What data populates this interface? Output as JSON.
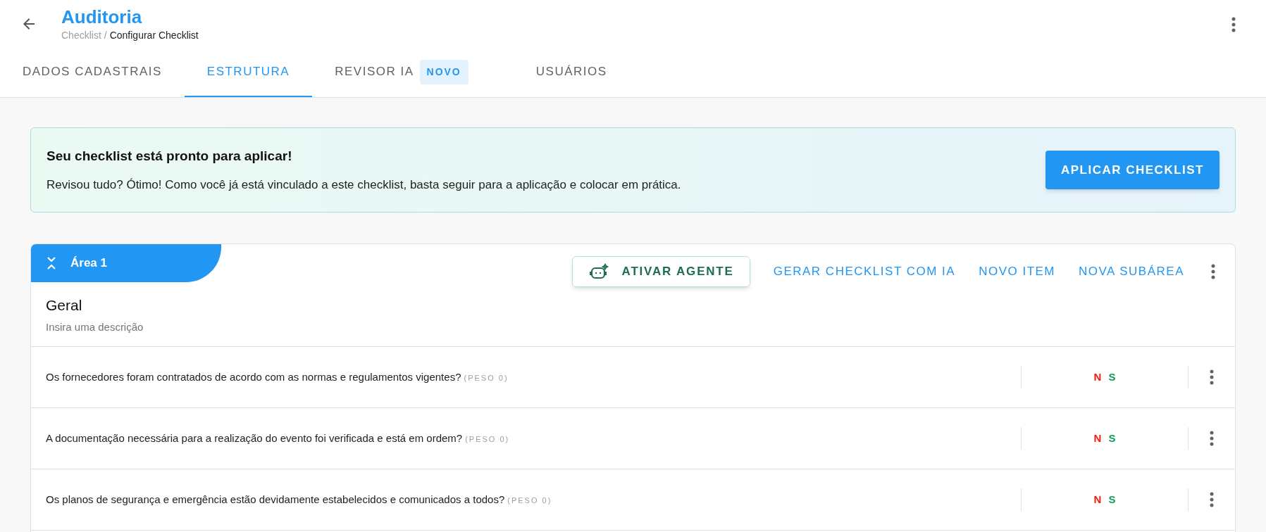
{
  "header": {
    "title": "Auditoria",
    "breadcrumb": [
      "Checklist",
      "Configurar Checklist"
    ],
    "breadcrumb_separator": "/"
  },
  "tabs": [
    {
      "label": "DADOS CADASTRAIS",
      "selected": false
    },
    {
      "label": "ESTRUTURA",
      "selected": true
    },
    {
      "label": "REVISOR IA",
      "badge": "NOVO",
      "selected": false
    },
    {
      "label": "USUÁRIOS",
      "selected": false
    }
  ],
  "banner": {
    "title": "Seu checklist está pronto para aplicar!",
    "text": "Revisou tudo? Ótimo! Como você já está vinculado a este checklist, basta seguir para a aplicação e colocar em prática.",
    "button": "APLICAR CHECKLIST"
  },
  "area": {
    "label": "Área 1",
    "agent_button": "ATIVAR AGENTE",
    "actions": [
      "GERAR CHECKLIST COM IA",
      "NOVO ITEM",
      "NOVA SUBÁREA"
    ],
    "name": "Geral",
    "description": "Insira uma descrição",
    "items": [
      {
        "question": "Os fornecedores foram contratados de acordo com as normas e regulamentos vigentes?",
        "weight": "(PESO 0)",
        "answers": [
          "N",
          "S"
        ]
      },
      {
        "question": "A documentação necessária para a realização do evento foi verificada e está em ordem?",
        "weight": "(PESO 0)",
        "answers": [
          "N",
          "S"
        ]
      },
      {
        "question": "Os planos de segurança e emergência estão devidamente estabelecidos e comunicados a todos?",
        "weight": "(PESO 0)",
        "answers": [
          "N",
          "S"
        ]
      }
    ]
  }
}
